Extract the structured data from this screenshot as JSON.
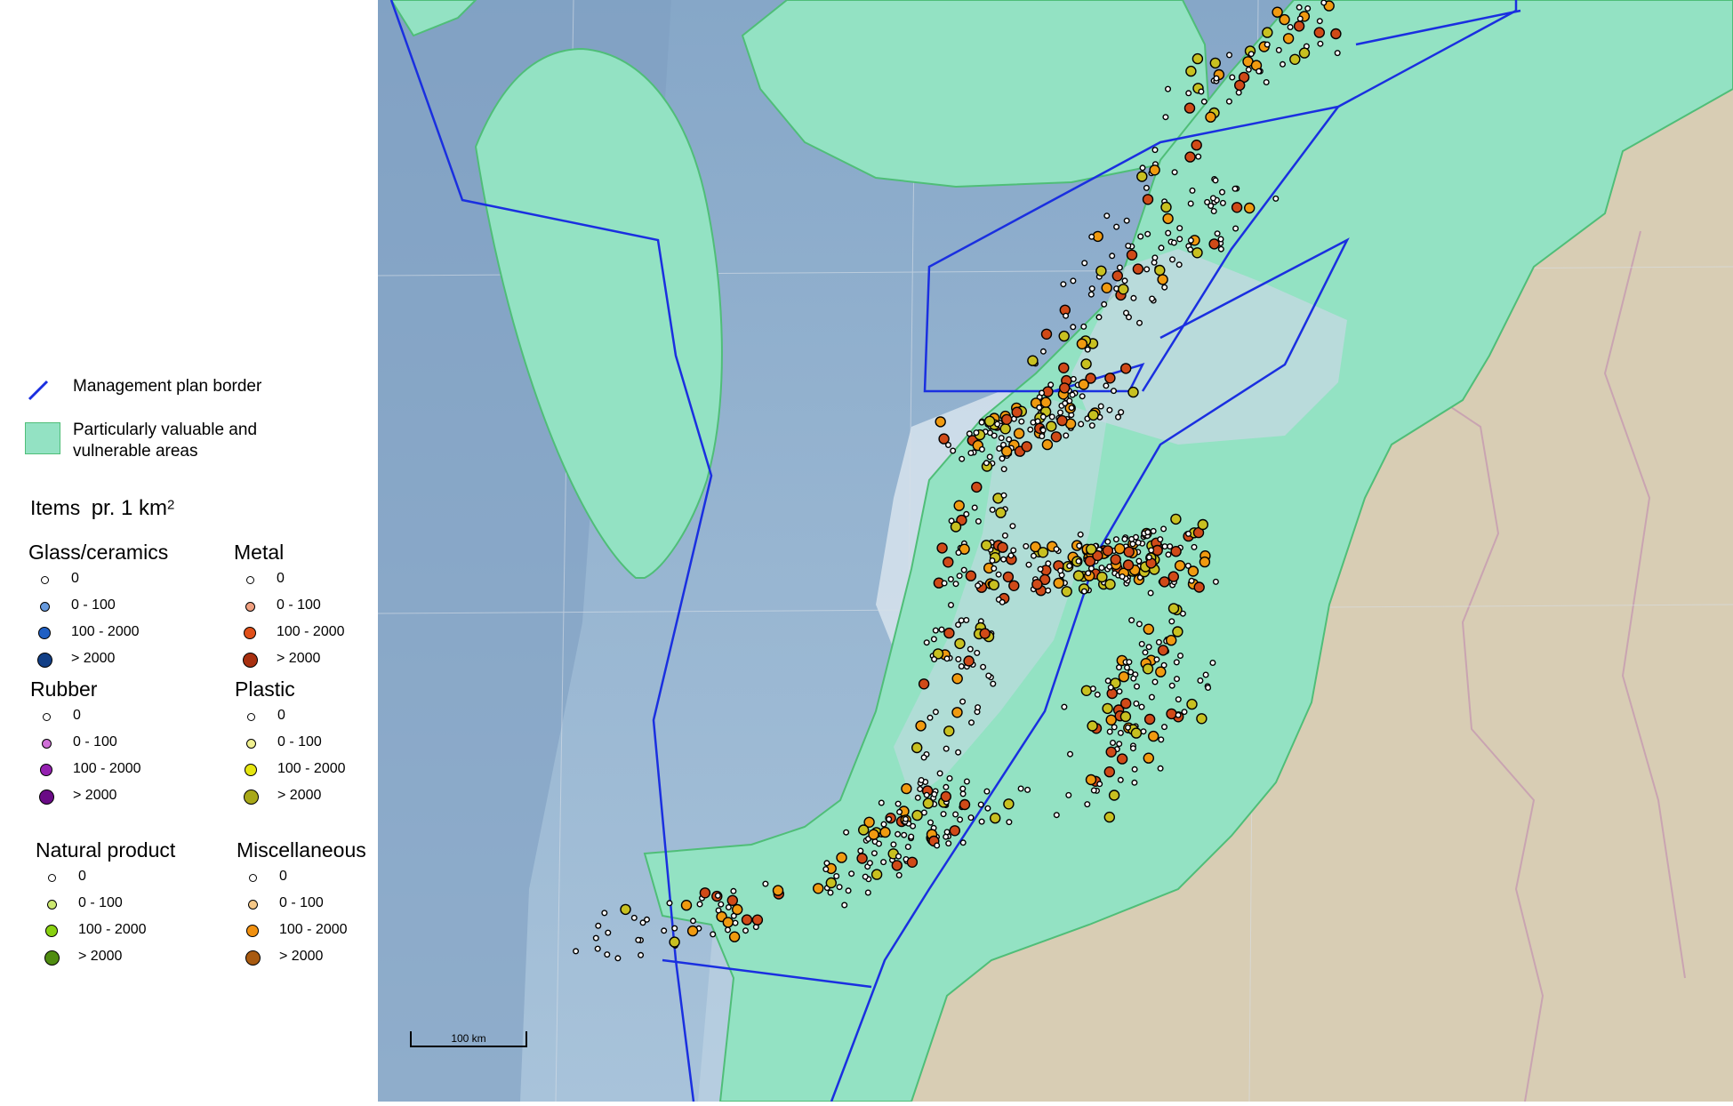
{
  "legend": {
    "border_label": "Management plan border",
    "area_label": "Particularly valuable and vulnerable areas",
    "items_title": "Items",
    "items_unit": "pr. 1 km",
    "items_unit_sup": "2",
    "categories": [
      {
        "name": "Glass/ceramics",
        "levels": [
          "0",
          "0 - 100",
          "100 - 2000",
          "> 2000"
        ],
        "colors": [
          "#ffffff",
          "#6699dd",
          "#1f5fc4",
          "#123f86"
        ]
      },
      {
        "name": "Metal",
        "levels": [
          "0",
          "0 - 100",
          "100 - 2000",
          "> 2000"
        ],
        "colors": [
          "#ffffff",
          "#f0a080",
          "#e0501a",
          "#a83010"
        ]
      },
      {
        "name": "Rubber",
        "levels": [
          "0",
          "0 - 100",
          "100 - 2000",
          "> 2000"
        ],
        "colors": [
          "#ffffff",
          "#d070d8",
          "#9420b0",
          "#6a0a86"
        ]
      },
      {
        "name": "Plastic",
        "levels": [
          "0",
          "0 - 100",
          "100 - 2000",
          "> 2000"
        ],
        "colors": [
          "#ffffff",
          "#f0f090",
          "#e5e510",
          "#a8a818"
        ]
      },
      {
        "name": "Natural product",
        "levels": [
          "0",
          "0 - 100",
          "100 - 2000",
          "> 2000"
        ],
        "colors": [
          "#ffffff",
          "#cce870",
          "#88d010",
          "#4f8c10"
        ]
      },
      {
        "name": "Miscellaneous",
        "levels": [
          "0",
          "0 - 100",
          "100 - 2000",
          "> 2000"
        ],
        "colors": [
          "#ffffff",
          "#f5c888",
          "#f09010",
          "#a85a10"
        ]
      }
    ]
  },
  "map": {
    "scale_label": "100 km",
    "colors": {
      "sea": "#8fb1cf",
      "sea_deep": "#7d9fc0",
      "shelf": "#c9d9e6",
      "land": "#d8cdb4",
      "valuable_area": "#93e2c3",
      "valuable_edge": "#4fbe78",
      "border": "#1a2fe0",
      "marker_orange": "#f09a10",
      "marker_red": "#d04a18",
      "marker_olive": "#c8c020"
    }
  }
}
